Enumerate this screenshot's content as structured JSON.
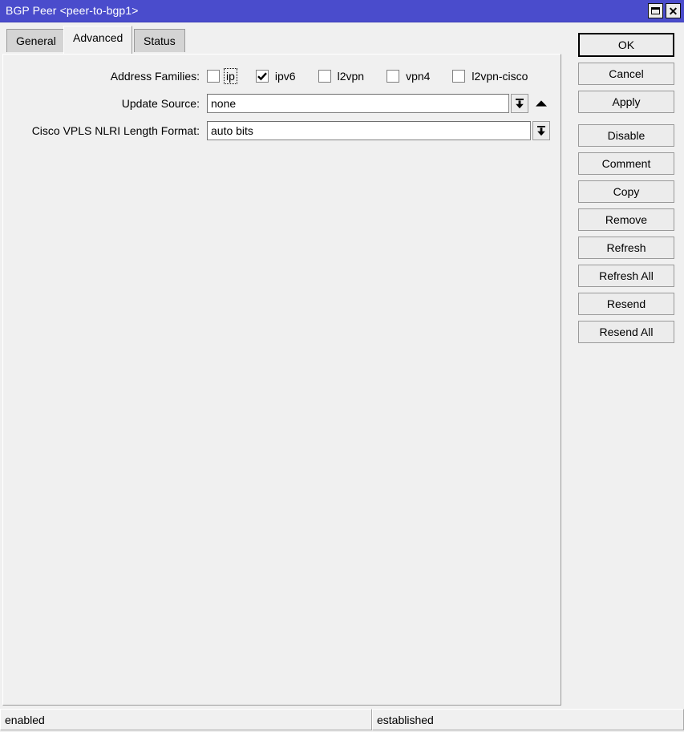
{
  "window": {
    "title": "BGP Peer <peer-to-bgp1>",
    "titlebar_color": "#4a4ccc",
    "restore_label": "Restore",
    "close_label": "Close"
  },
  "tabs": [
    {
      "label": "General",
      "active": false
    },
    {
      "label": "Advanced",
      "active": true
    },
    {
      "label": "Status",
      "active": false
    }
  ],
  "form": {
    "address_families": {
      "label": "Address Families:",
      "options": [
        {
          "label": "ip",
          "checked": false,
          "focused": true
        },
        {
          "label": "ipv6",
          "checked": true,
          "focused": false
        },
        {
          "label": "l2vpn",
          "checked": false,
          "focused": false
        },
        {
          "label": "vpn4",
          "checked": false,
          "focused": false
        },
        {
          "label": "l2vpn-cisco",
          "checked": false,
          "focused": false
        }
      ]
    },
    "update_source": {
      "label": "Update Source:",
      "value": "none",
      "placeholder": ""
    },
    "cisco_vpls_nlri": {
      "label": "Cisco VPLS NLRI Length Format:",
      "value": "auto bits",
      "placeholder": ""
    }
  },
  "buttons": [
    {
      "label": "OK",
      "default": true,
      "gap_before": false
    },
    {
      "label": "Cancel",
      "default": false,
      "gap_before": false
    },
    {
      "label": "Apply",
      "default": false,
      "gap_before": false
    },
    {
      "label": "Disable",
      "default": false,
      "gap_before": true
    },
    {
      "label": "Comment",
      "default": false,
      "gap_before": false
    },
    {
      "label": "Copy",
      "default": false,
      "gap_before": false
    },
    {
      "label": "Remove",
      "default": false,
      "gap_before": false
    },
    {
      "label": "Refresh",
      "default": false,
      "gap_before": false
    },
    {
      "label": "Refresh All",
      "default": false,
      "gap_before": false
    },
    {
      "label": "Resend",
      "default": false,
      "gap_before": false
    },
    {
      "label": "Resend All",
      "default": false,
      "gap_before": false
    }
  ],
  "statusbar": {
    "left": "enabled",
    "right": "established"
  }
}
